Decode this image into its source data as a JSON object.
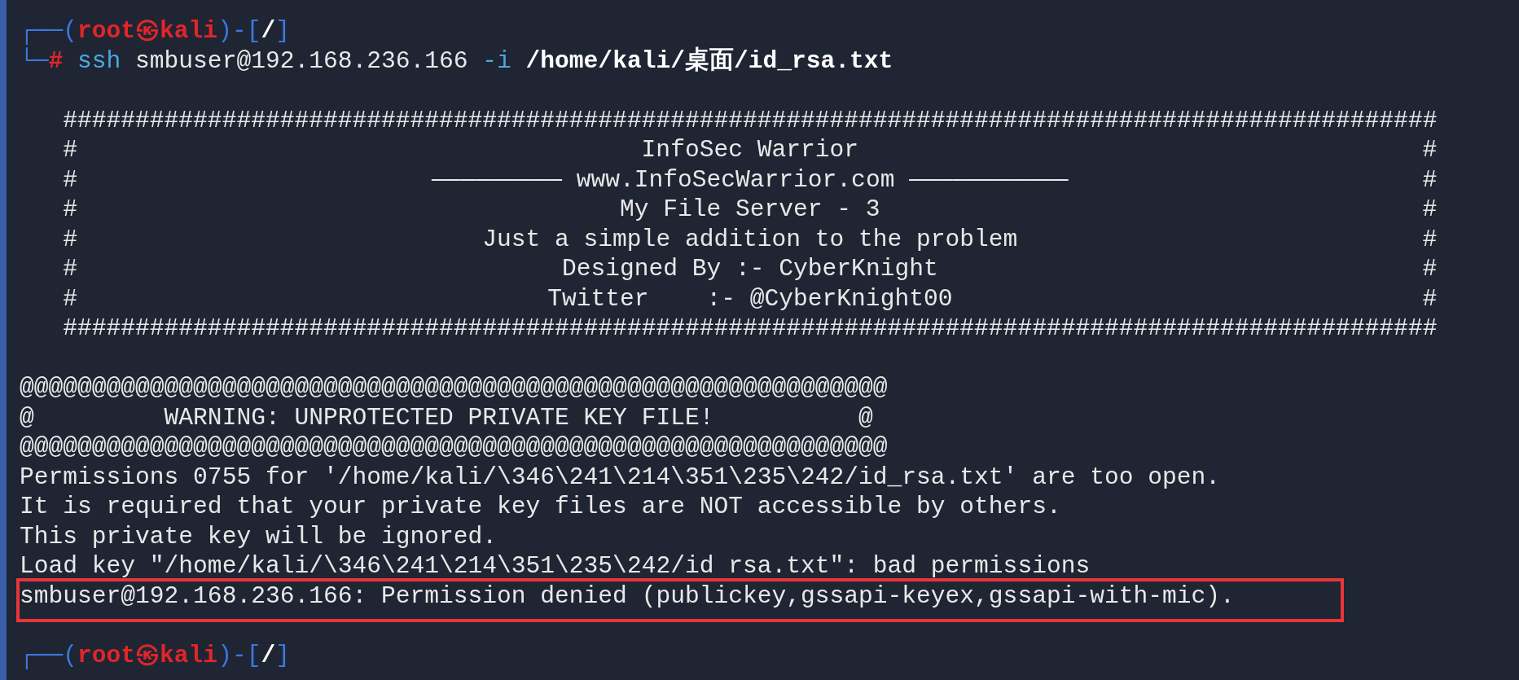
{
  "terminal": {
    "lines": [
      {
        "kind": "prompt",
        "frame_start": "┌──(",
        "user": "root㉿kali",
        "frame_mid": ")-[",
        "path": "/",
        "frame_end": "]"
      },
      {
        "kind": "command",
        "frame": "└─",
        "mark": "#",
        "program": "ssh",
        "arguments": "smbuser@192.168.236.166",
        "option": "-i",
        "file": "/home/kali/桌面/id_rsa.txt"
      },
      {
        "kind": "blank"
      },
      {
        "kind": "output",
        "text": "   ###############################################################################################",
        "highlighted": false
      },
      {
        "kind": "banner",
        "left": "#",
        "text": "InfoSec Warrior",
        "right": "#"
      },
      {
        "kind": "banner",
        "left": "#",
        "text": "————————— www.InfoSecWarrior.com ———————————",
        "right": "#"
      },
      {
        "kind": "banner",
        "left": "#",
        "text": "My File Server - 3",
        "right": "#"
      },
      {
        "kind": "banner",
        "left": "#",
        "text": "Just a simple addition to the problem",
        "right": "#"
      },
      {
        "kind": "banner",
        "left": "#",
        "text": "Designed By :- CyberKnight",
        "right": "#"
      },
      {
        "kind": "banner",
        "left": "#",
        "text": "Twitter    :- @CyberKnight00",
        "right": "#"
      },
      {
        "kind": "output",
        "text": "   ###############################################################################################",
        "highlighted": false
      },
      {
        "kind": "blank"
      },
      {
        "kind": "output",
        "text": "@@@@@@@@@@@@@@@@@@@@@@@@@@@@@@@@@@@@@@@@@@@@@@@@@@@@@@@@@@@@",
        "highlighted": false
      },
      {
        "kind": "output",
        "text": "@         WARNING: UNPROTECTED PRIVATE KEY FILE!          @",
        "highlighted": false
      },
      {
        "kind": "output",
        "text": "@@@@@@@@@@@@@@@@@@@@@@@@@@@@@@@@@@@@@@@@@@@@@@@@@@@@@@@@@@@@",
        "highlighted": false
      },
      {
        "kind": "output",
        "text": "Permissions 0755 for '/home/kali/\\346\\241\\214\\351\\235\\242/id_rsa.txt' are too open.",
        "highlighted": false
      },
      {
        "kind": "output",
        "text": "It is required that your private key files are NOT accessible by others.",
        "highlighted": false
      },
      {
        "kind": "output",
        "text": "This private key will be ignored.",
        "highlighted": false
      },
      {
        "kind": "output",
        "text": "Load key \"/home/kali/\\346\\241\\214\\351\\235\\242/id rsa.txt\": bad permissions",
        "highlighted": false
      },
      {
        "kind": "output",
        "text": "smbuser@192.168.236.166: Permission denied (publickey,gssapi-keyex,gssapi-with-mic).",
        "highlighted": true
      },
      {
        "kind": "blank"
      },
      {
        "kind": "prompt",
        "frame_start": "┌──(",
        "user": "root㉿kali",
        "frame_mid": ")-[",
        "path": "/",
        "frame_end": "]"
      }
    ]
  }
}
